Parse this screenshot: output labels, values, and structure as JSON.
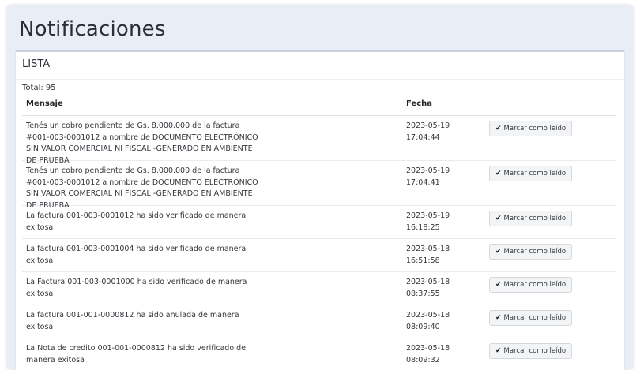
{
  "page": {
    "title": "Notificaciones"
  },
  "card": {
    "header": "LISTA",
    "total": "Total: 95"
  },
  "table": {
    "columns": {
      "message": "Mensaje",
      "date": "Fecha"
    },
    "button_label": "Marcar como leído",
    "rows": [
      {
        "message": "Tenés un cobro pendiente de Gs. 8.000.000 de la factura #001-003-0001012 a nombre de DOCUMENTO ELECTRÓNICO SIN VALOR COMERCIAL NI FISCAL -GENERADO EN AMBIENTE DE PRUEBA",
        "date": "2023-05-19",
        "time": "17:04:44"
      },
      {
        "message": "Tenés un cobro pendiente de Gs. 8.000.000 de la factura #001-003-0001012 a nombre de DOCUMENTO ELECTRÓNICO SIN VALOR COMERCIAL NI FISCAL -GENERADO EN AMBIENTE DE PRUEBA",
        "date": "2023-05-19",
        "time": "17:04:41"
      },
      {
        "message": "La factura 001-003-0001012 ha sido verificado de manera exitosa",
        "date": "2023-05-19",
        "time": "16:18:25"
      },
      {
        "message": "La factura 001-003-0001004 ha sido verificado de manera exitosa",
        "date": "2023-05-18",
        "time": "16:51:58"
      },
      {
        "message": "La Factura 001-003-0001000 ha sido verificado de manera exitosa",
        "date": "2023-05-18",
        "time": "08:37:55"
      },
      {
        "message": "La factura 001-001-0000812 ha sido anulada de manera exitosa",
        "date": "2023-05-18",
        "time": "08:09:40"
      },
      {
        "message": "La Nota de credito 001-001-0000812 ha sido verificado de manera exitosa",
        "date": "2023-05-18",
        "time": "08:09:32"
      }
    ]
  }
}
